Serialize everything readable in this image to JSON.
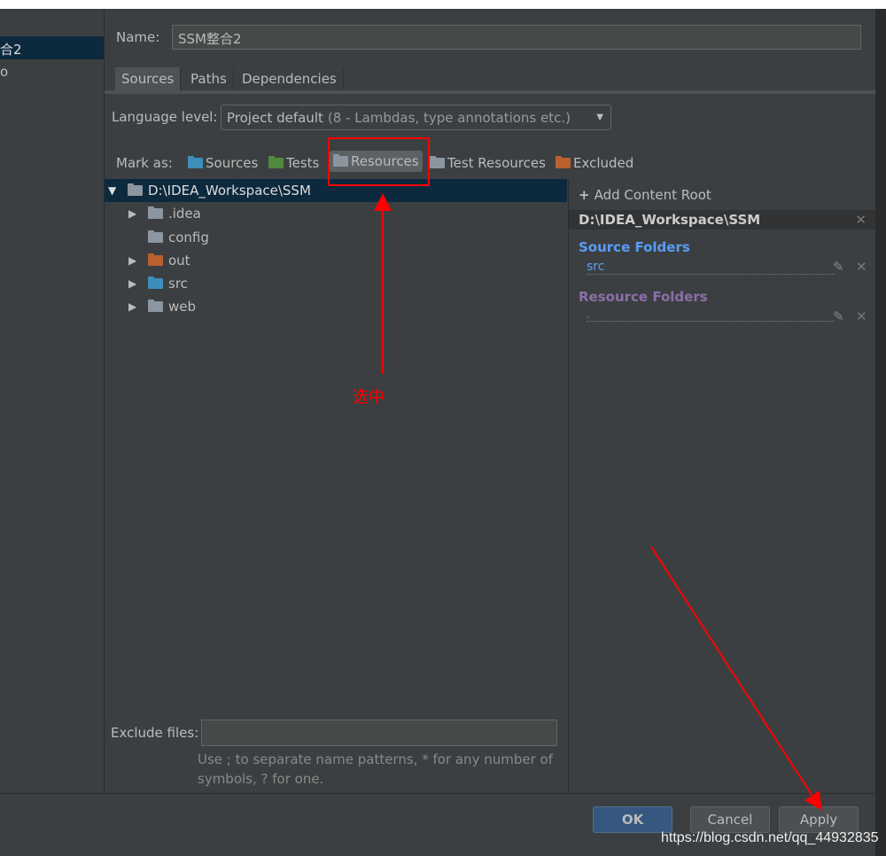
{
  "left_panel": {
    "items": [
      "合2",
      "o"
    ]
  },
  "name": {
    "label": "Name:",
    "value": "SSM整合2"
  },
  "tabs": [
    "Sources",
    "Paths",
    "Dependencies"
  ],
  "language_level": {
    "label": "Language level:",
    "value": "Project default",
    "hint": "(8 - Lambdas, type annotations etc.)"
  },
  "mark_as": {
    "label": "Mark as:",
    "items": [
      {
        "label": "Sources",
        "color": "#3d8eb9"
      },
      {
        "label": "Tests",
        "color": "#4f8a3c"
      },
      {
        "label": "Resources",
        "color": "#8c96a0"
      },
      {
        "label": "Test Resources",
        "color": "#8c96a0"
      },
      {
        "label": "Excluded",
        "color": "#b8612f"
      }
    ]
  },
  "tree": {
    "root": "D:\\IDEA_Workspace\\SSM",
    "children": [
      {
        "label": ".idea",
        "color": "#8c96a0",
        "expandable": true
      },
      {
        "label": "config",
        "color": "#8c96a0",
        "expandable": false
      },
      {
        "label": "out",
        "color": "#b8612f",
        "expandable": true
      },
      {
        "label": "src",
        "color": "#3d8eb9",
        "expandable": true
      },
      {
        "label": "web",
        "color": "#8c96a0",
        "expandable": true
      }
    ]
  },
  "right": {
    "add_root": "Add Content Root",
    "root": "D:\\IDEA_Workspace\\SSM",
    "source_heading": "Source Folders",
    "source_item": "src",
    "resource_heading": "Resource Folders",
    "resource_item": "."
  },
  "exclude": {
    "label": "Exclude files:",
    "value": "",
    "hint1": "Use ; to separate name patterns, * for any number of",
    "hint2": "symbols, ? for one."
  },
  "buttons": {
    "ok": "OK",
    "cancel": "Cancel",
    "apply": "Apply"
  },
  "annotation": {
    "text": "选中",
    "color": "#ff0000"
  },
  "watermark": "https://blog.csdn.net/qq_44932835"
}
